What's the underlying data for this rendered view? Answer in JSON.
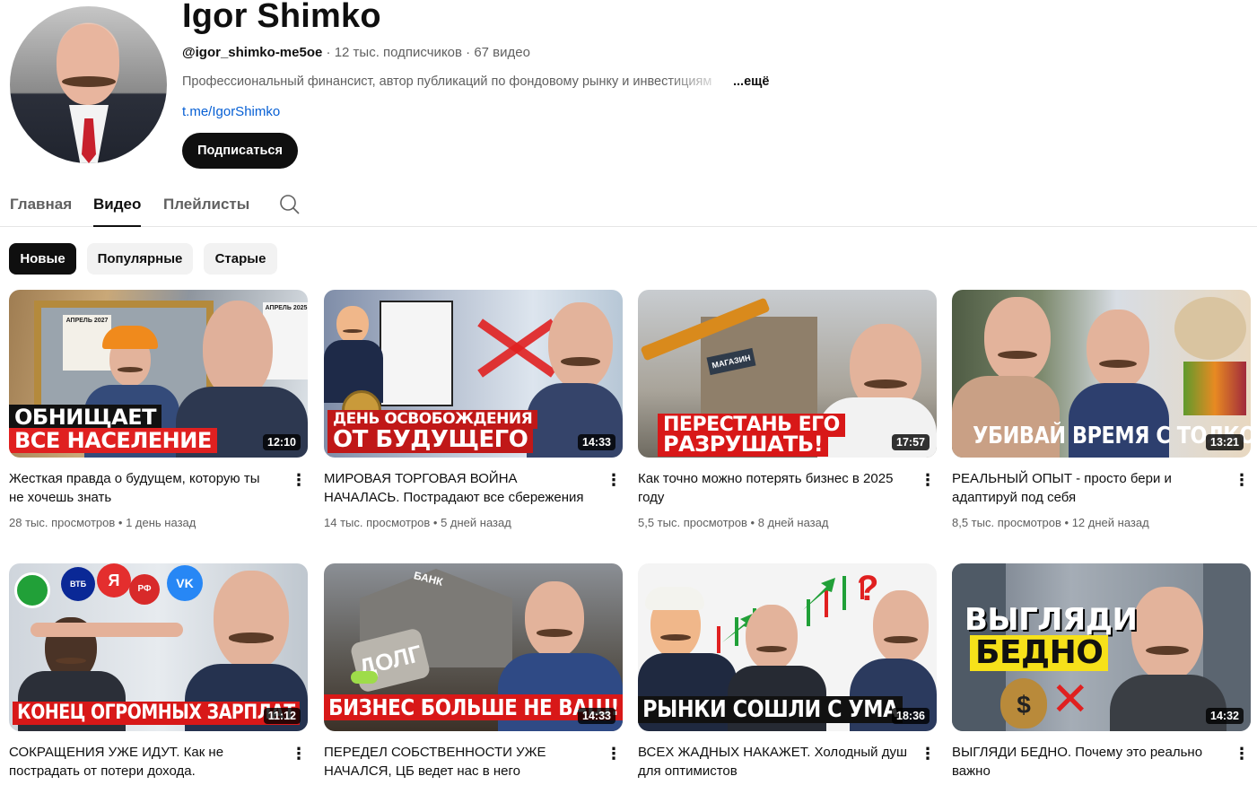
{
  "channel": {
    "name": "Igor Shimko",
    "handle": "@igor_shimko-me5oe",
    "subscribers": "12 тыс. подписчиков",
    "videos": "67 видео",
    "description": "Профессиональный финансист, автор публикаций по фондовому рынку и инвестициям",
    "more_label": "...ещё",
    "link": "t.me/IgorShimko",
    "subscribe_label": "Подписаться",
    "separator": "·"
  },
  "tabs": [
    {
      "label": "Главная",
      "active": false
    },
    {
      "label": "Видео",
      "active": true
    },
    {
      "label": "Плейлисты",
      "active": false
    }
  ],
  "chips": [
    {
      "label": "Новые",
      "active": true
    },
    {
      "label": "Популярные",
      "active": false
    },
    {
      "label": "Старые",
      "active": false
    }
  ],
  "videos": [
    {
      "title": "Жесткая правда о будущем, которую ты не хочешь знать",
      "duration": "12:10",
      "views": "28 тыс. просмотров",
      "age": "1 день назад",
      "caption_lines": [
        "ОБНИЩАЕТ",
        "ВСЕ НАСЕЛЕНИЕ"
      ],
      "calendar_labels": [
        "АПРЕЛЬ 2027",
        "АПРЕЛЬ 2025"
      ]
    },
    {
      "title": "МИРОВАЯ ТОРГОВАЯ ВОЙНА НАЧАЛАСЬ. Пострадают все сбережения",
      "duration": "14:33",
      "views": "14 тыс. просмотров",
      "age": "5 дней назад",
      "caption_lines": [
        "ДЕНЬ ОСВОБОЖДЕНИЯ",
        "ОТ БУДУЩЕГО"
      ]
    },
    {
      "title": "Как точно можно потерять бизнес в 2025 году",
      "duration": "17:57",
      "views": "5,5 тыс. просмотров",
      "age": "8 дней назад",
      "caption_lines": [
        "ПЕРЕСТАНЬ ЕГО",
        "РАЗРУШАТЬ!"
      ],
      "sign_label": "МАГАЗИН"
    },
    {
      "title": "РЕАЛЬНЫЙ ОПЫТ - просто бери и адаптируй под себя",
      "duration": "13:21",
      "views": "8,5 тыс. просмотров",
      "age": "12 дней назад",
      "caption_lines": [
        "УБИВАЙ ВРЕМЯ С ТОЛКОМ"
      ]
    },
    {
      "title": "СОКРАЩЕНИЯ УЖЕ ИДУТ. Как не пострадать от потери дохода.",
      "duration": "11:12",
      "views": "",
      "age": "",
      "caption_lines": [
        "КОНЕЦ ОГРОМНЫХ ЗАРПЛАТ"
      ],
      "bank_icons": [
        "ВТБ",
        "Я",
        "РФ",
        "VK"
      ]
    },
    {
      "title": "ПЕРЕДЕЛ СОБСТВЕННОСТИ УЖЕ НАЧАЛСЯ, ЦБ ведет нас в него",
      "duration": "14:33",
      "views": "",
      "age": "",
      "caption_lines": [
        "БИЗНЕС БОЛЬШЕ НЕ ВАШ!"
      ],
      "sign_label": "БАНК",
      "debt_label": "ДОЛГ"
    },
    {
      "title": "ВСЕХ ЖАДНЫХ НАКАЖЕТ. Холодный душ для оптимистов",
      "duration": "18:36",
      "views": "",
      "age": "",
      "caption_lines": [
        "РЫНКИ СОШЛИ С УМА"
      ]
    },
    {
      "title": "ВЫГЛЯДИ БЕДНО. Почему это реально важно",
      "duration": "14:32",
      "views": "",
      "age": "",
      "caption_lines": [
        "ВЫГЛЯДИ",
        "БЕДНО"
      ]
    }
  ],
  "colors": {
    "accent_red": "#e02020",
    "subscribe_bg": "#0f0f0f",
    "link": "#065fd4",
    "chip_bg": "#f2f2f2",
    "yellow_caption": "#f6e11a"
  },
  "icons": {
    "search_tab": "search-icon",
    "video_menu": "more-vert-icon"
  }
}
